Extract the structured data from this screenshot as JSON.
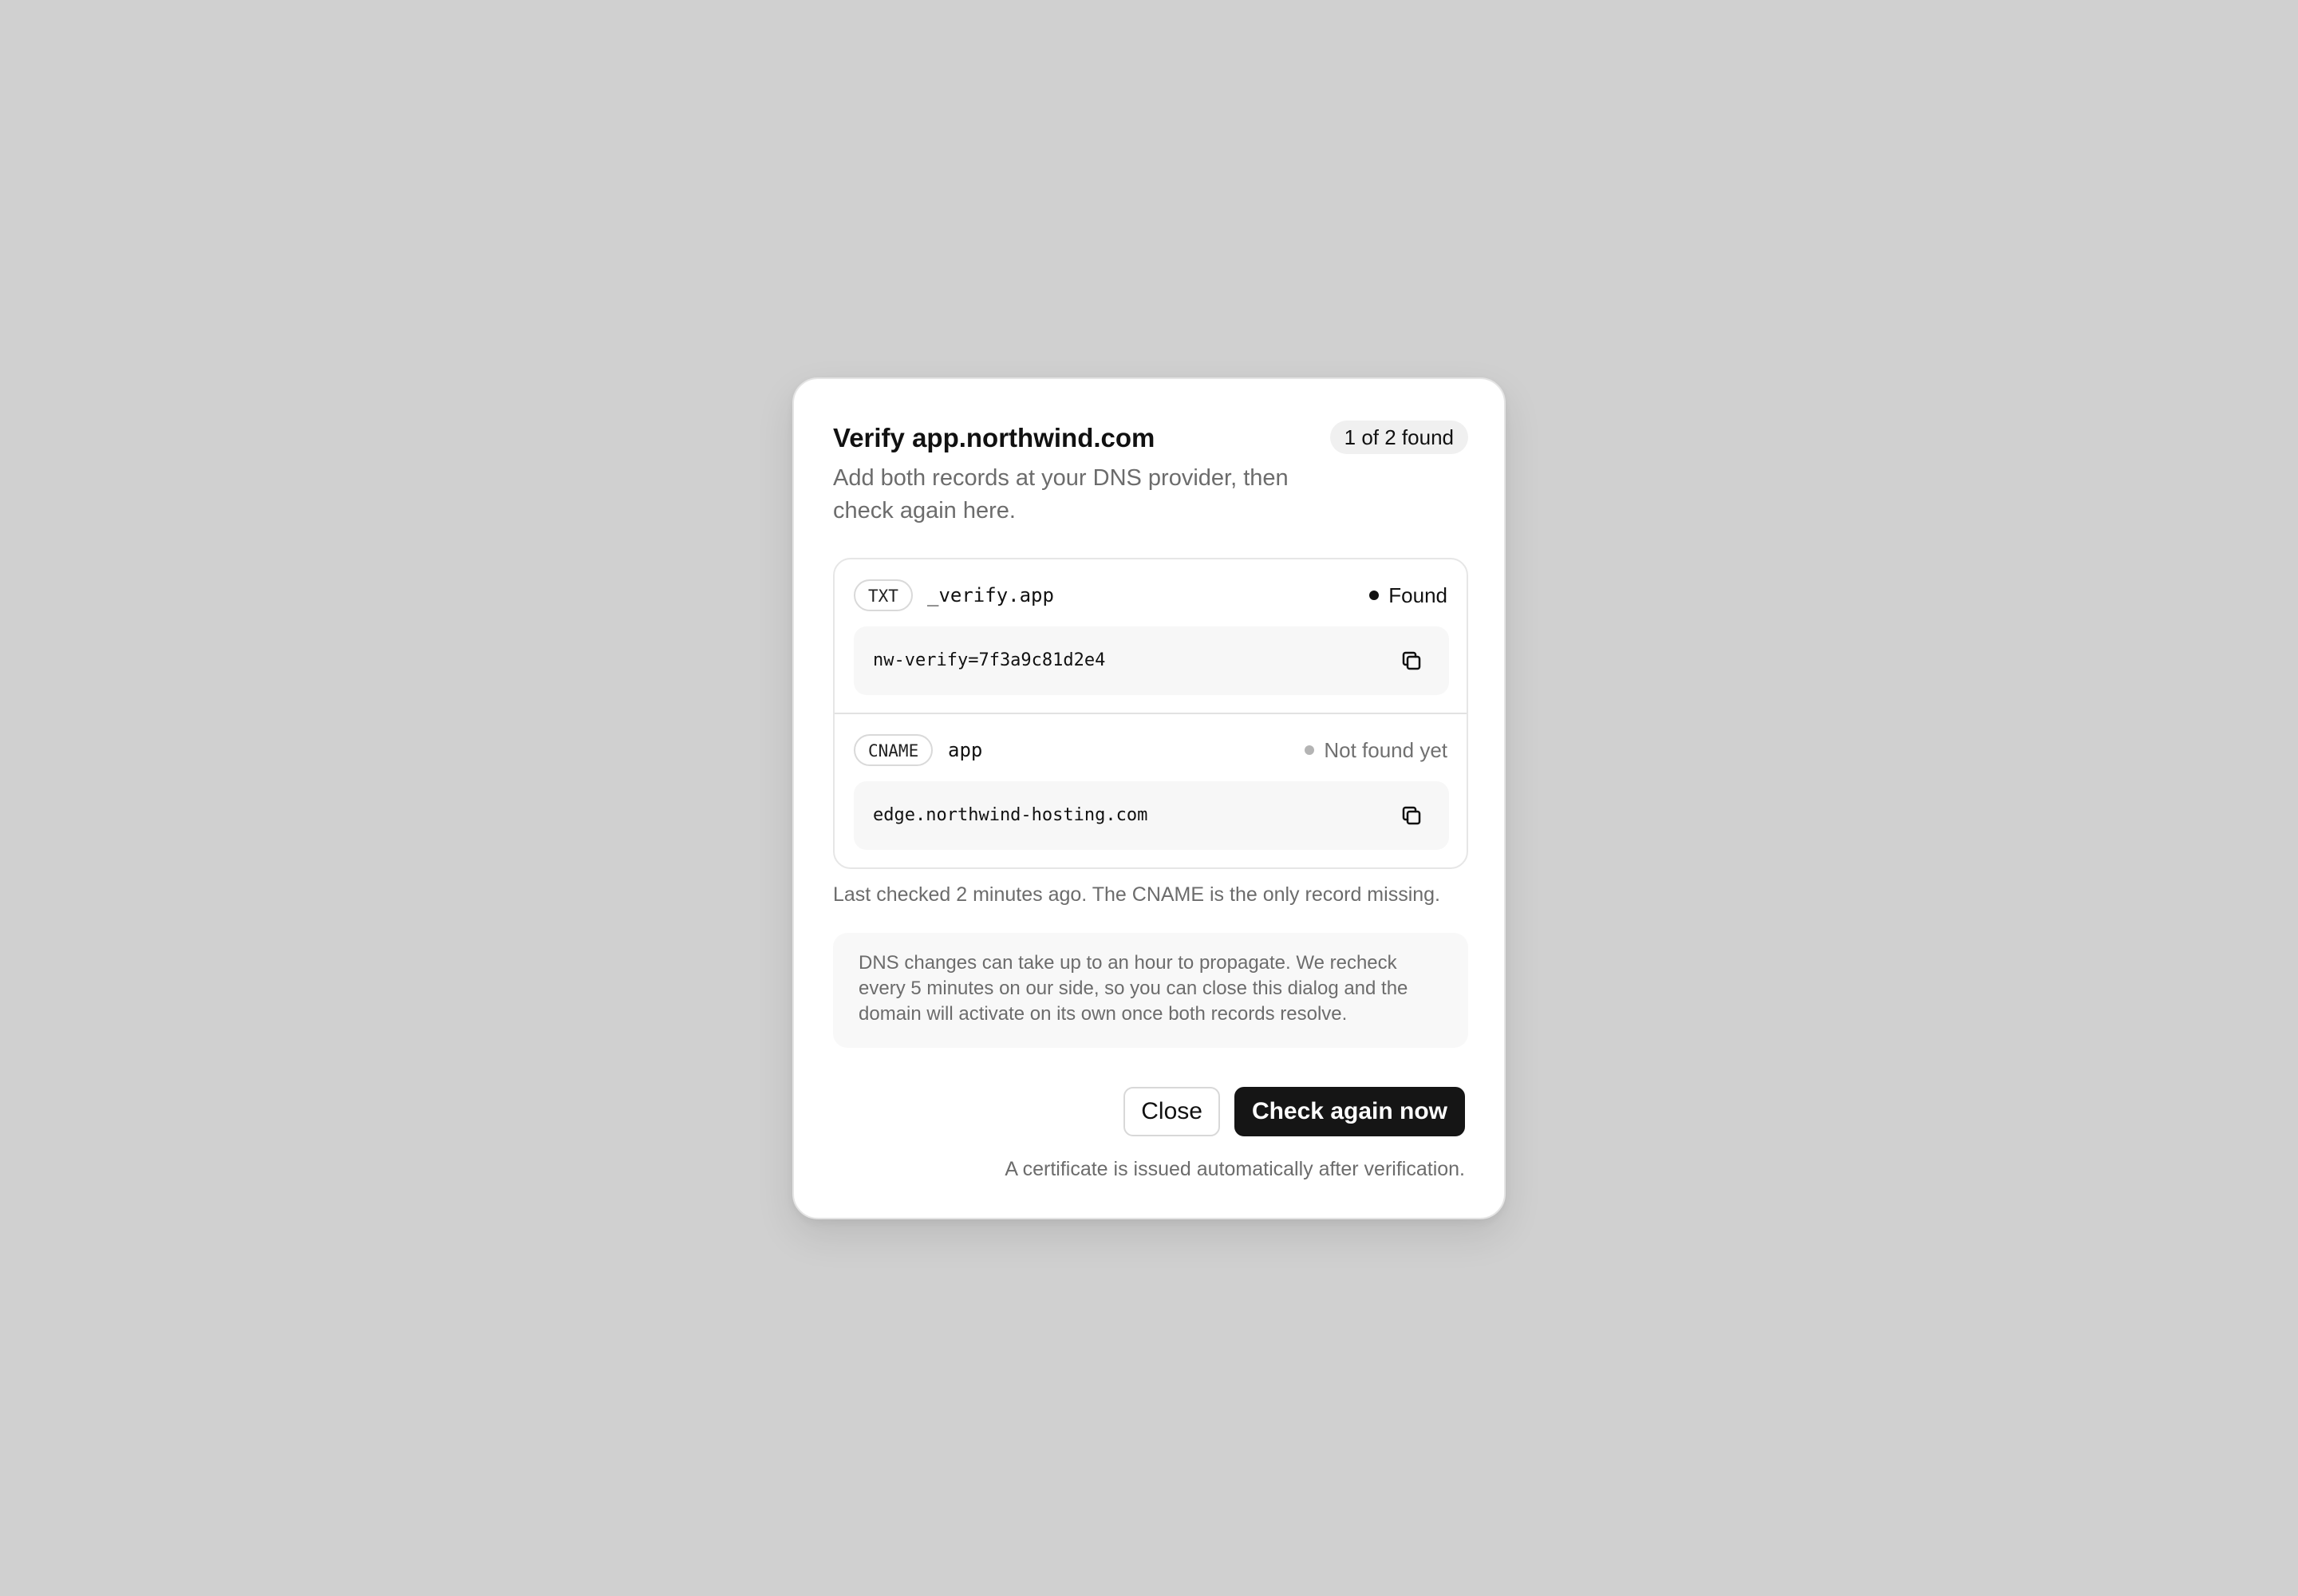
{
  "dialog": {
    "title": "Verify app.northwind.com",
    "badge": "1 of 2 found",
    "subtitle": "Add both records at your DNS provider, then check again here.",
    "records": [
      {
        "type": "TXT",
        "host": "_verify.app",
        "status": "Found",
        "value": "nw-verify=7f3a9c81d2e4",
        "copy_icon": "copy-icon"
      },
      {
        "type": "CNAME",
        "host": "app",
        "status": "Not found yet",
        "value": "edge.northwind-hosting.com",
        "copy_icon": "copy-icon"
      }
    ],
    "last_checked": "Last checked 2 minutes ago. The CNAME is the only record missing.",
    "info": "DNS changes can take up to an hour to propagate. We recheck every 5 minutes on our side, so you can close this dialog and the domain will activate on its own once both records resolve.",
    "close_label": "Close",
    "check_label": "Check again now",
    "footnote": "A certificate is issued automatically after verification."
  },
  "colors": {
    "backdrop": "#d0d0d0",
    "primary_button": "#151515",
    "found_dot": "#111111",
    "missing_dot": "#b4b4b4"
  }
}
